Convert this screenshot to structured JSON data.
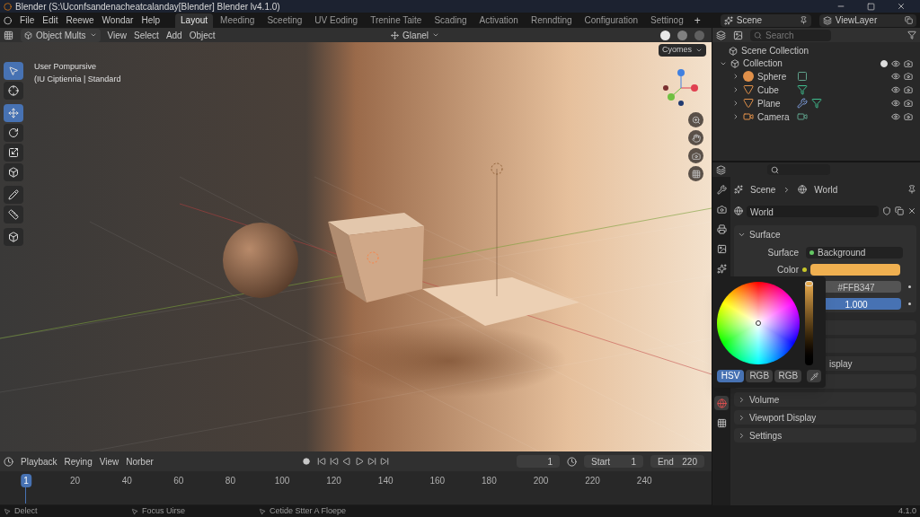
{
  "title_bar": {
    "title": "Blender (S:\\Uconfsandenacheatcalanday[Blender] Blender lv4.1.0)"
  },
  "menu": [
    "File",
    "Edit",
    "Reewe",
    "Wondar",
    "Help"
  ],
  "workspaces": [
    {
      "label": "Layout",
      "selected": true
    },
    {
      "label": "Meeding",
      "selected": false
    },
    {
      "label": "Sceeting",
      "selected": false
    },
    {
      "label": "UV Eoding",
      "selected": false
    },
    {
      "label": "Trenine Taite",
      "selected": false
    },
    {
      "label": "Scading",
      "selected": false
    },
    {
      "label": "Activation",
      "selected": false
    },
    {
      "label": "Renndting",
      "selected": false
    },
    {
      "label": "Configuration",
      "selected": false
    },
    {
      "label": "Settinog",
      "selected": false
    }
  ],
  "add_workspace": "+",
  "scene": "Scene",
  "view_layer": "ViewLayer",
  "viewport_header": {
    "mode": "Object Mults",
    "menus": [
      "View",
      "Select",
      "Add",
      "Object"
    ],
    "orientation": "Glanel"
  },
  "viewport": {
    "info": [
      "User Pompursive",
      "(IU Ciptienria | Standard"
    ],
    "view_menu": "Cyomes",
    "tools": [
      {
        "kind": "select",
        "selected": true
      },
      {
        "kind": "cursor",
        "selected": false
      },
      {
        "kind": "move",
        "selected": true
      },
      {
        "kind": "rotate",
        "selected": false
      },
      {
        "kind": "scale",
        "selected": false
      },
      {
        "kind": "transform",
        "selected": false
      },
      {
        "kind": "annotate",
        "selected": false
      },
      {
        "kind": "measure",
        "selected": false
      },
      {
        "kind": "add_cube",
        "selected": false
      }
    ]
  },
  "outliner": {
    "search": {
      "placeholder": "Search"
    },
    "root": "Scene Collection",
    "collection": {
      "label": "Collection",
      "expanded": true,
      "checked": true,
      "children": [
        {
          "label": "Sphere",
          "kind": "sphere"
        },
        {
          "label": "Cube",
          "kind": "mesh"
        },
        {
          "label": "Plane",
          "kind": "mesh_modifier"
        },
        {
          "label": "Camera",
          "kind": "camera"
        }
      ]
    }
  },
  "properties": {
    "breadcrumb": [
      "Scene",
      "World"
    ],
    "world": "World",
    "tabs": [
      {
        "kind": "tool",
        "selected": false
      },
      {
        "kind": "render",
        "selected": false
      },
      {
        "kind": "output",
        "selected": false
      },
      {
        "kind": "view_layer",
        "selected": false
      },
      {
        "kind": "scene",
        "selected": false
      },
      {
        "kind": "world",
        "selected": true
      },
      {
        "kind": "texture",
        "selected": false
      }
    ],
    "surface": {
      "title": "Surface",
      "expanded": true,
      "surface_label": "Surface",
      "surface_value": "Background",
      "color_label": "Color",
      "color": "#f0b050",
      "hex": "#FFB347",
      "strength": "1.000"
    },
    "hidden_row": "isplay",
    "sections": [
      {
        "title": "Volume",
        "expanded": false
      },
      {
        "title": "Viewport Display",
        "expanded": false
      },
      {
        "title": "Settings",
        "expanded": false
      }
    ]
  },
  "color_picker": {
    "level": 1,
    "modes": [
      {
        "label": "HSV",
        "selected": true
      },
      {
        "label": "RGB",
        "selected": false
      },
      {
        "label": "RGB",
        "selected": false
      }
    ]
  },
  "timeline": {
    "menus": [
      "Playback",
      "Reying",
      "View",
      "Norber"
    ],
    "current_frame": "1",
    "start_label": "Start",
    "start": "1",
    "end_label": "End",
    "end": "220",
    "ticks": [
      "1",
      "20",
      "40",
      "60",
      "80",
      "100",
      "120",
      "140",
      "160",
      "180",
      "200",
      "220",
      "240"
    ]
  },
  "status_bar": {
    "items": [
      "Delect",
      "Focus Uirse",
      "Cetide Stter A Floepe"
    ],
    "version": "4.1.0"
  }
}
